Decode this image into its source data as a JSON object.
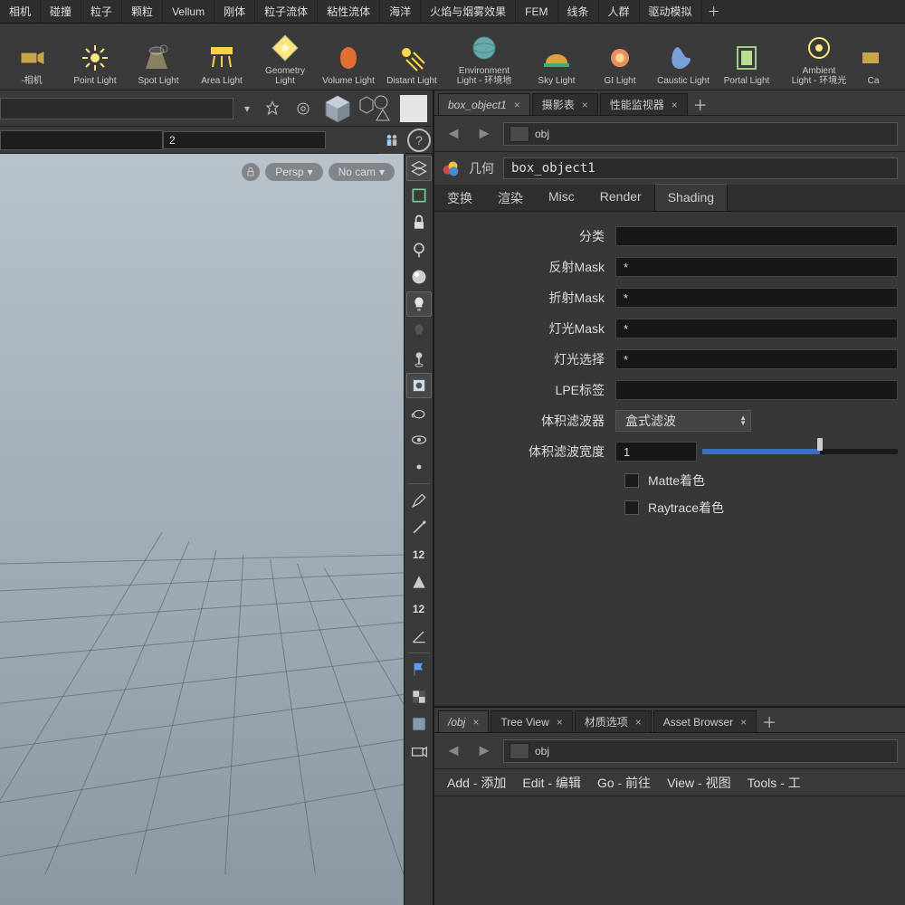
{
  "menubar": {
    "items": [
      "相机",
      "碰撞",
      "粒子",
      "颗粒",
      "Vellum",
      "刚体",
      "粒子流体",
      "粘性流体",
      "海洋",
      "火焰与烟雾效果",
      "FEM",
      "线条",
      "人群",
      "驱动模拟"
    ]
  },
  "shelf": {
    "tools": [
      {
        "label": "-相机",
        "icon": "camera"
      },
      {
        "label": "Point Light",
        "icon": "point"
      },
      {
        "label": "Spot Light",
        "icon": "spot"
      },
      {
        "label": "Area Light",
        "icon": "area"
      },
      {
        "label": "Geometry\nLight",
        "icon": "geom"
      },
      {
        "label": "Volume Light",
        "icon": "vol"
      },
      {
        "label": "Distant Light",
        "icon": "dist"
      },
      {
        "label": "Environment\nLight - 环境地",
        "icon": "env",
        "wide": true
      },
      {
        "label": "Sky Light",
        "icon": "sky"
      },
      {
        "label": "GI Light",
        "icon": "gi"
      },
      {
        "label": "Caustic Light",
        "icon": "caustic"
      },
      {
        "label": "Portal Light",
        "icon": "portal"
      },
      {
        "label": "Ambient\nLight - 环境光",
        "icon": "amb",
        "wide": true
      },
      {
        "label": "Ca",
        "icon": "cam2"
      }
    ]
  },
  "left": {
    "row2_value": "2",
    "persp_label": "Persp",
    "nocam_label": "No cam"
  },
  "path": {
    "label": "obj"
  },
  "node": {
    "type": "几何",
    "name": "box_object1"
  },
  "tabs_top": [
    {
      "label": "box_object1",
      "active": true,
      "italic": true
    },
    {
      "label": "摄影表",
      "active": false
    },
    {
      "label": "性能监视器",
      "active": false
    }
  ],
  "sub_tabs": [
    "变换",
    "渲染",
    "Misc",
    "Render",
    "Shading"
  ],
  "sub_active": 4,
  "params": {
    "category": {
      "label": "分类",
      "value": ""
    },
    "reflectmask": {
      "label": "反射Mask",
      "value": "*"
    },
    "refractmask": {
      "label": "折射Mask",
      "value": "*"
    },
    "lightmask": {
      "label": "灯光Mask",
      "value": "*"
    },
    "lightsel": {
      "label": "灯光选择",
      "value": "*"
    },
    "lpe": {
      "label": "LPE标签",
      "value": ""
    },
    "volfilter": {
      "label": "体积滤波器",
      "value": "盒式滤波"
    },
    "volwidth": {
      "label": "体积滤波宽度",
      "value": "1",
      "slider_pct": 60
    },
    "matte": {
      "label": "Matte着色"
    },
    "raytrace": {
      "label": "Raytrace着色"
    }
  },
  "net": {
    "tabs": [
      {
        "label": "/obj",
        "italic": true,
        "active": true
      },
      {
        "label": "Tree View"
      },
      {
        "label": "材质选项"
      },
      {
        "label": "Asset Browser"
      }
    ],
    "path": "obj",
    "menu": [
      "Add - 添加",
      "Edit - 编辑",
      "Go - 前往",
      "View - 视图",
      "Tools - 工"
    ]
  },
  "vtool_nums": {
    "a": "12",
    "b": "12"
  }
}
